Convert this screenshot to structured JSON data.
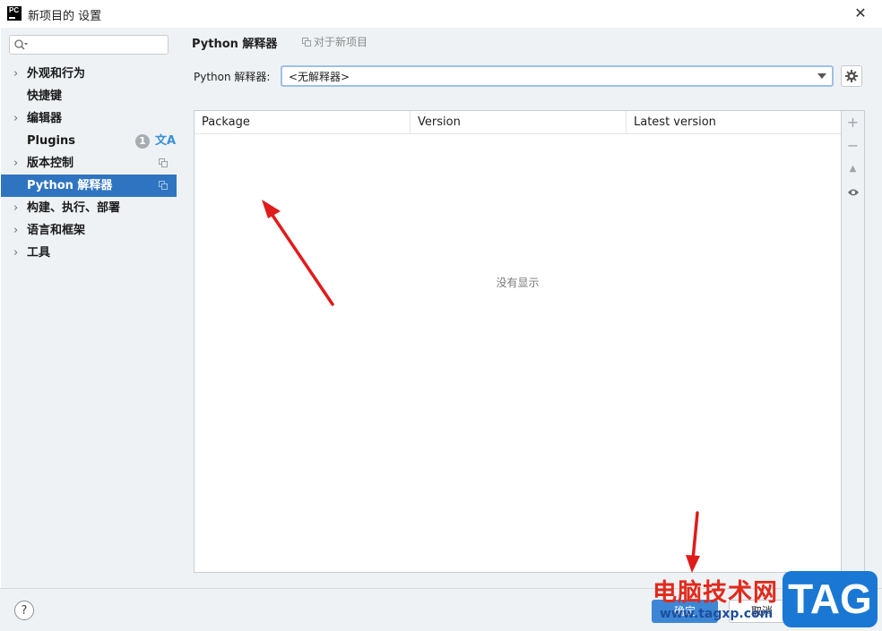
{
  "window": {
    "title": "新项目的 设置"
  },
  "search": {
    "placeholder": ""
  },
  "sidebar": {
    "items": [
      {
        "label": "外观和行为"
      },
      {
        "label": "快捷键"
      },
      {
        "label": "编辑器"
      },
      {
        "label": "Plugins",
        "badge": "1"
      },
      {
        "label": "版本控制"
      },
      {
        "label": "Python 解释器"
      },
      {
        "label": "构建、执行、部署"
      },
      {
        "label": "语言和框架"
      },
      {
        "label": "工具"
      }
    ]
  },
  "header": {
    "title": "Python 解释器",
    "project_label": "对于新项目"
  },
  "interpreter": {
    "label": "Python 解释器:",
    "value": "<无解释器>"
  },
  "packages": {
    "columns": [
      "Package",
      "Version",
      "Latest version"
    ],
    "rows": [],
    "empty_text": "没有显示"
  },
  "footer": {
    "help": "?",
    "ok": "确定",
    "cancel": "取消"
  },
  "watermark": {
    "site_name": "电脑技术网",
    "url": "www.tagxp.com",
    "logo": "TAG"
  },
  "colors": {
    "selected": "#2f74c0",
    "annotation_arrow": "#e01b1b",
    "primary_button": "#3d86d6"
  }
}
